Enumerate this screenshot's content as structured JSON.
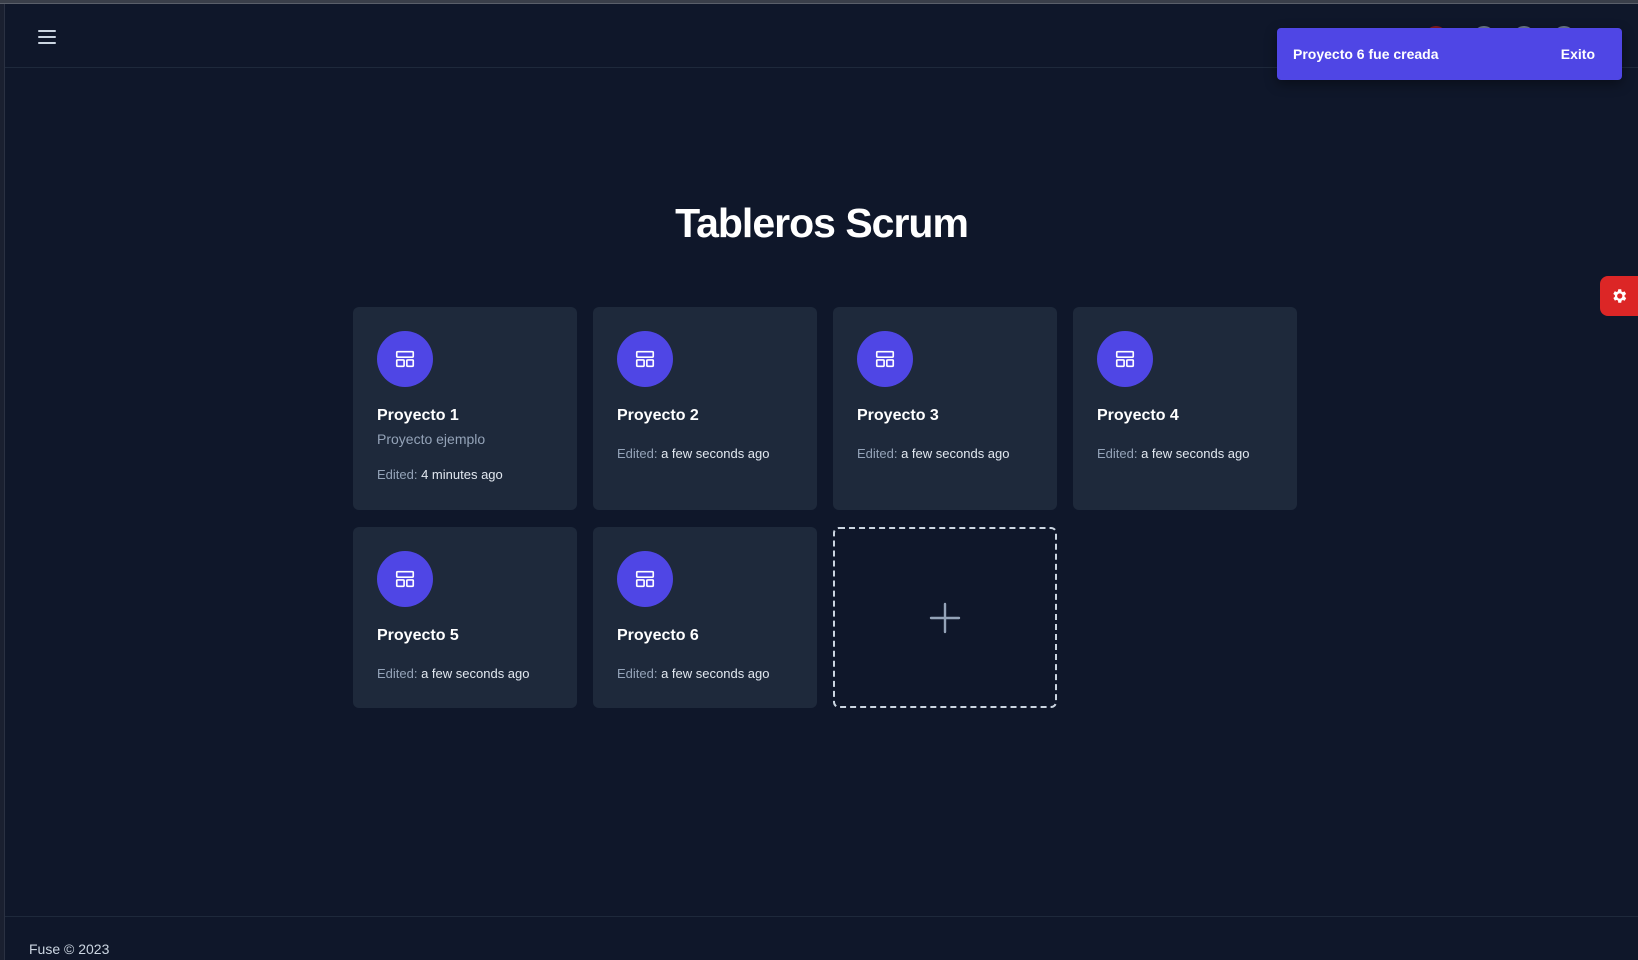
{
  "page": {
    "title": "Tableros Scrum"
  },
  "header": {
    "menu_icon": "menu-icon"
  },
  "toast": {
    "message": "Proyecto 6 fue creada",
    "action": "Exito",
    "color": "#4f46e5"
  },
  "settings": {
    "icon": "gear-icon",
    "color": "#dc2626"
  },
  "edited_label": "Edited:",
  "boards": [
    {
      "name": "Proyecto 1",
      "description": "Proyecto ejemplo",
      "edited": "4 minutes ago"
    },
    {
      "name": "Proyecto 2",
      "description": "",
      "edited": "a few seconds ago"
    },
    {
      "name": "Proyecto 3",
      "description": "",
      "edited": "a few seconds ago"
    },
    {
      "name": "Proyecto 4",
      "description": "",
      "edited": "a few seconds ago"
    },
    {
      "name": "Proyecto 5",
      "description": "",
      "edited": "a few seconds ago"
    },
    {
      "name": "Proyecto 6",
      "description": "",
      "edited": "a few seconds ago"
    }
  ],
  "add_board": {
    "icon": "plus-icon"
  },
  "footer": {
    "text": "Fuse © 2023"
  }
}
